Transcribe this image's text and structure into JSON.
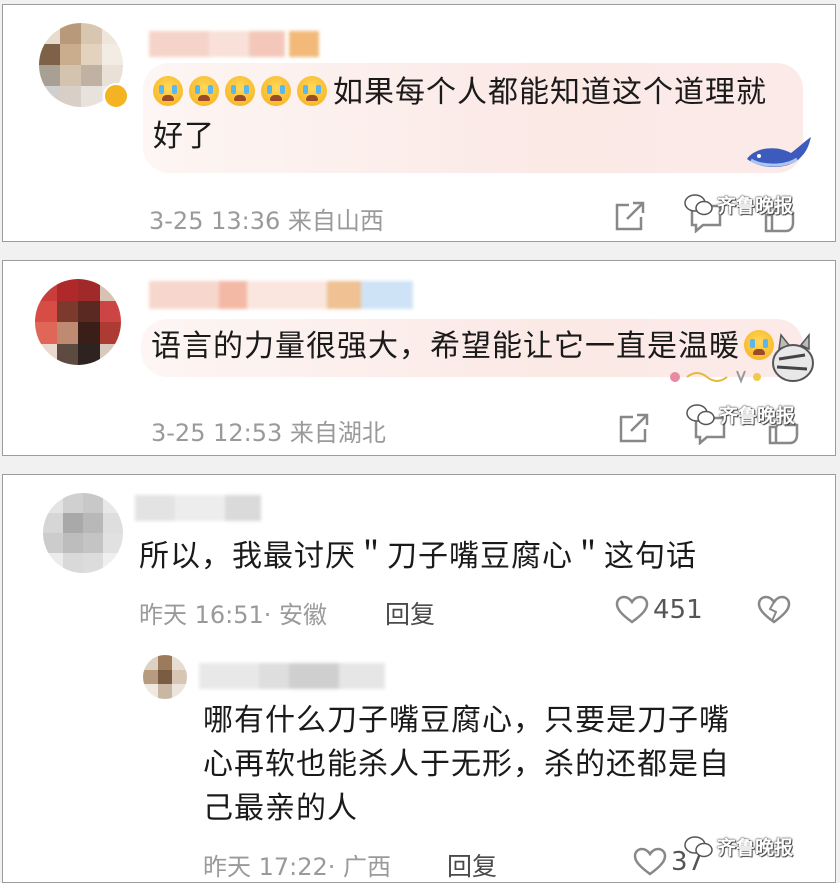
{
  "colors": {
    "bubble": "#fbe9e6",
    "meta": "#9a9a9a",
    "text": "#1a1a1a",
    "icon": "#888888"
  },
  "watermark": "齐鲁晚报",
  "comments": [
    {
      "text": "如果每个人都能知道这个道理就",
      "text_line2": "好了",
      "meta": "3-25 13:36 来自山西",
      "emoji_count": 5
    },
    {
      "text": "语言的力量很强大，希望能让它一直是温暖",
      "meta": "3-25 12:53 来自湖北"
    },
    {
      "text": "所以，我最讨厌＂刀子嘴豆腐心＂这句话",
      "meta": "昨天 16:51· 安徽",
      "reply": "回复",
      "likes": "451",
      "reply_comment": {
        "line1": "哪有什么刀子嘴豆腐心，只要是刀子嘴",
        "line2": "心再软也能杀人于无形，杀的还都是自",
        "line3": "己最亲的人",
        "meta": "昨天 17:22· 广西",
        "reply": "回复",
        "likes": "37"
      }
    }
  ]
}
